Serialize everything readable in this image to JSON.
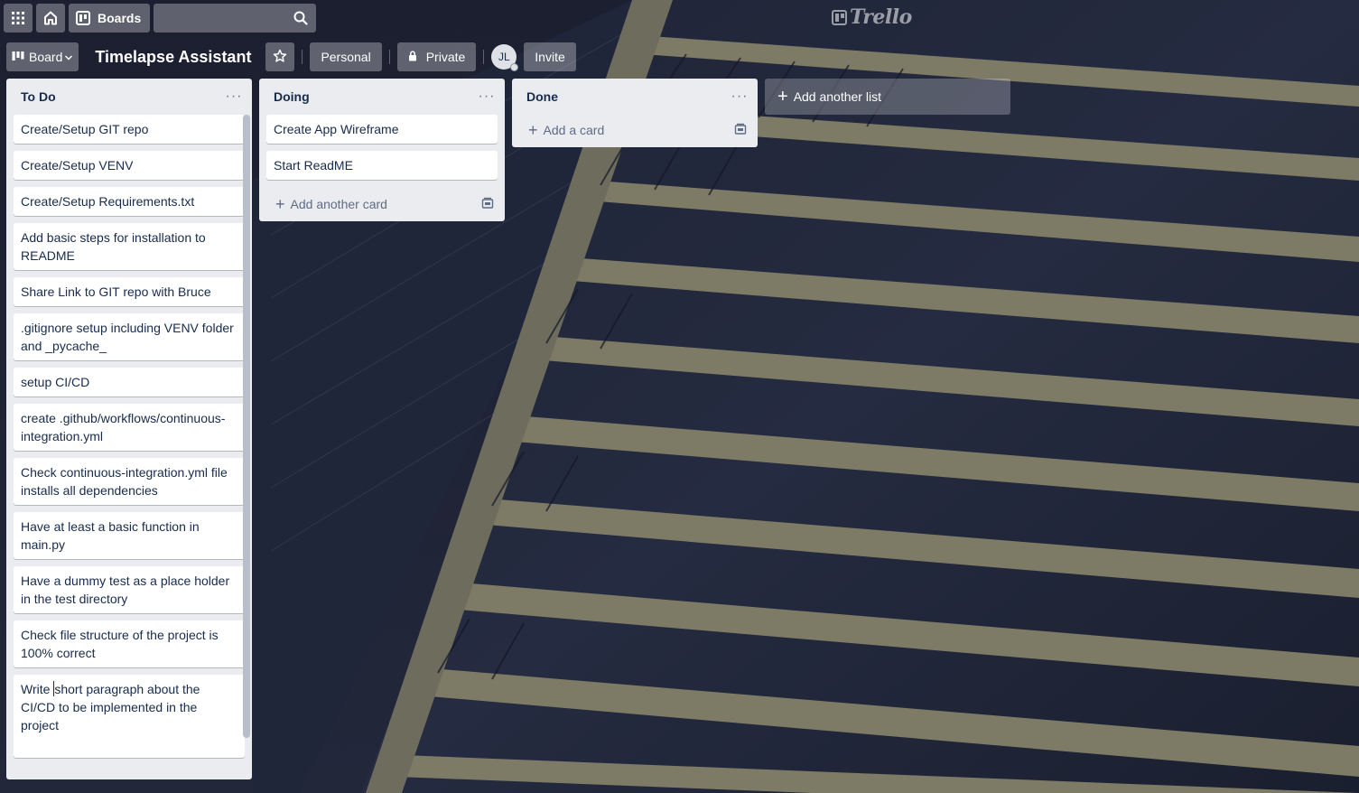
{
  "colors": {
    "list_bg": "#ebecf0",
    "card_bg": "#ffffff",
    "text": "#172b4d",
    "muted": "#5e6c84",
    "button_overlay": "rgba(255,255,255,0.3)"
  },
  "topbar": {
    "apps_icon": "grid-icon",
    "home_icon": "home-icon",
    "boards_icon": "boards-icon",
    "boards_label": "Boards",
    "search_value": "",
    "search_icon": "search-icon",
    "logo_text": "Trello"
  },
  "board_header": {
    "view_label": "Board",
    "title": "Timelapse Assistant",
    "star_icon": "star-icon",
    "team_label": "Personal",
    "visibility_label": "Private",
    "member_initials": "JL",
    "invite_label": "Invite"
  },
  "lists": [
    {
      "title": "To Do",
      "cards": [
        "Create/Setup GIT repo",
        "Create/Setup VENV",
        "Create/Setup Requirements.txt",
        "Add basic steps for installation to README",
        "Share Link to GIT repo with Bruce",
        ".gitignore setup including VENV folder and _pycache_",
        "setup CI/CD",
        "create .github/workflows/continuous-integration.yml",
        "Check continuous-integration.yml file installs all dependencies",
        "Have at least a basic function in main.py",
        "Have a dummy test as a place holder in the test directory",
        "Check file structure of the project is 100% correct"
      ],
      "editing_card_before": "Write ",
      "editing_card_after": "short paragraph about the CI/CD to be implemented in the project"
    },
    {
      "title": "Doing",
      "cards": [
        "Create App Wireframe",
        "Start ReadME"
      ],
      "add_label": "Add another card"
    },
    {
      "title": "Done",
      "cards": [],
      "add_label": "Add a card"
    }
  ],
  "add_list_label": "Add another list"
}
